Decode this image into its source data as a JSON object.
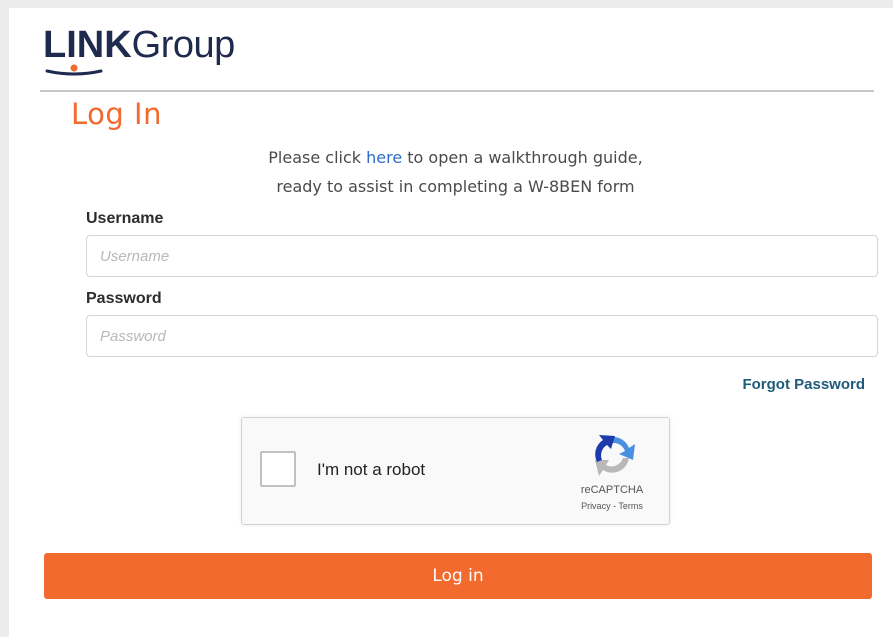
{
  "brand": {
    "logo_bold": "LINK",
    "logo_regular": "Group"
  },
  "page_title": "Log In",
  "intro": {
    "prefix": "Please click ",
    "link_text": "here",
    "suffix_line1": " to open a walkthrough guide,",
    "line2": "ready to assist in completing a W-8BEN form"
  },
  "form": {
    "username_label": "Username",
    "username_placeholder": "Username",
    "username_value": "",
    "password_label": "Password",
    "password_placeholder": "Password",
    "password_value": "",
    "forgot_password": "Forgot Password"
  },
  "recaptcha": {
    "checkbox_label": "I'm not a robot",
    "checked": false,
    "brand": "reCAPTCHA",
    "privacy": "Privacy",
    "separator": " - ",
    "terms": "Terms"
  },
  "submit_label": "Log in",
  "colors": {
    "accent_orange": "#f26a2e",
    "logo_navy": "#1f2a4f",
    "link_blue": "#2e6bc9",
    "forgot_link": "#1f5a7a"
  },
  "icons": [
    "link-group-logo-swoosh",
    "recaptcha-logo-icon"
  ]
}
